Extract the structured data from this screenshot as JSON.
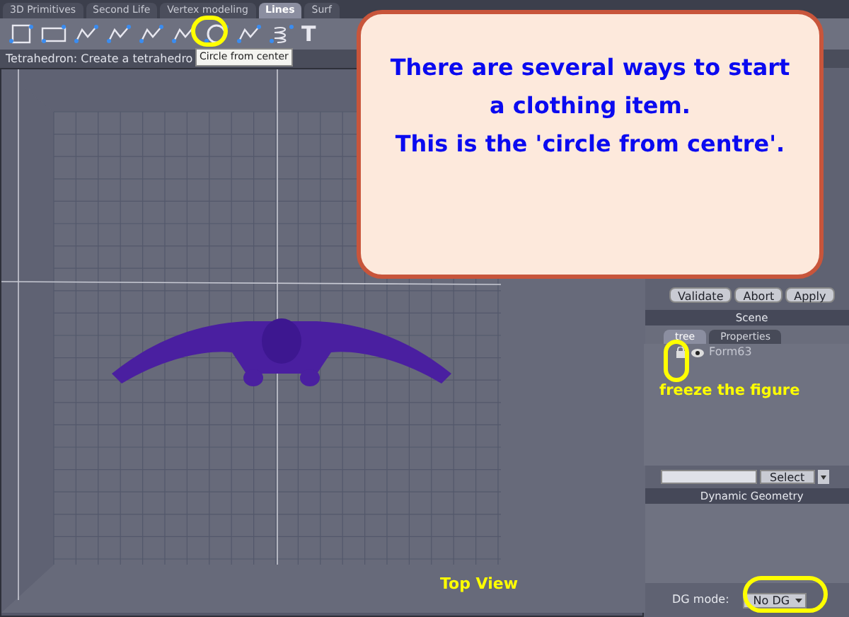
{
  "tabs": [
    {
      "label": "3D Primitives",
      "selected": false
    },
    {
      "label": "Second Life",
      "selected": false
    },
    {
      "label": "Vertex modeling",
      "selected": false
    },
    {
      "label": "Lines",
      "selected": true
    },
    {
      "label": "Surf",
      "selected": false
    }
  ],
  "toolbar": {
    "text_tool": "T"
  },
  "tooltip": "Circle from center",
  "status": "Tetrahedron: Create a tetrahedro",
  "viewport": {
    "label": "Top View"
  },
  "callout": {
    "lines": [
      "There are several ways to start",
      "a clothing item.",
      "This is the 'circle from centre'."
    ]
  },
  "action_buttons": [
    "Validate",
    "Abort",
    "Apply"
  ],
  "scene": {
    "title": "Scene",
    "tabs": [
      {
        "label": "tree",
        "selected": true
      },
      {
        "label": "Properties",
        "selected": false
      }
    ],
    "item": "Form63",
    "annotation": "freeze the figure",
    "select_button": "Select"
  },
  "dynamic_geometry": {
    "title": "Dynamic Geometry",
    "mode_label": "DG mode:",
    "mode_value": "No DG"
  }
}
